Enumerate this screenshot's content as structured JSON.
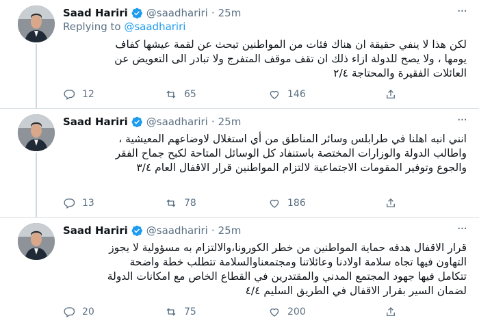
{
  "tweets": [
    {
      "name": "Saad Hariri",
      "handle": "@saadhariri",
      "dot": "·",
      "time": "25m",
      "more": "···",
      "replying_prefix": "Replying to ",
      "replying_handle": "@saadhariri",
      "lines": [
        "لكن هذا لا ينفي حقيقة ان هناك فئات من المواطنين تبحث عن لقمة عيشها كفاف",
        "يومها ، ولا يصح للدولة ازاء ذلك ان تقف موقف المتفرج ولا تبادر الى التعويض عن",
        "العائلات الفقيرة والمحتاجة ٢/٤"
      ],
      "replies": "12",
      "retweets": "65",
      "likes": "146"
    },
    {
      "name": "Saad Hariri",
      "handle": "@saadhariri",
      "dot": "·",
      "time": "25m",
      "more": "···",
      "lines": [
        "انني انبه اهلنا في طرابلس وسائر المناطق من أي استغلال لاوضاعهم المعيشية ،",
        "واطالب الدولة والوزارات المختصة باستنفاد كل الوسائل المتاحة لكبح جماح الفقر",
        "والجوع وتوفير المقومات الاجتماعية لالتزام المواطنين قرار الاقفال العام ٣/٤"
      ],
      "replies": "13",
      "retweets": "78",
      "likes": "186"
    },
    {
      "name": "Saad Hariri",
      "handle": "@saadhariri",
      "dot": "·",
      "time": "25m",
      "more": "···",
      "lines": [
        "قرار الاقفال هدفه حماية المواطنين من خطر الكورونا،والالتزام به مسؤولية لا يجوز",
        "التهاون فيها تجاه سلامة اولادنا وعائلاتنا ومجتمعناوالسلامة تتطلب خطة واضحة",
        "تتكامل فيها جهود المجتمع المدني والمقتدرين في القطاع الخاص مع امكانات الدولة",
        "لضمان السير بقرار الاقفال في الطريق السليم ٤/٤"
      ],
      "replies": "20",
      "retweets": "75",
      "likes": "200"
    }
  ],
  "colors": {
    "accent": "#1d9bf0",
    "muted": "#5b7083",
    "text": "#0f1419",
    "divider": "#d9dfe3"
  }
}
